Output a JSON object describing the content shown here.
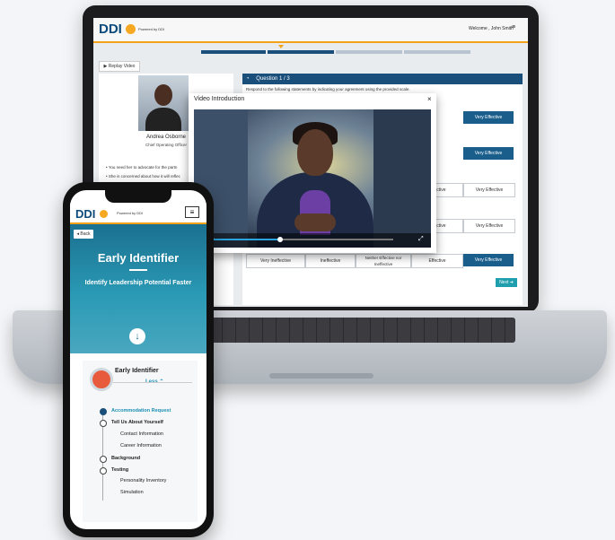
{
  "laptop": {
    "logo": "DDI",
    "powered_by": "Powered by DDI",
    "welcome": "Welcome , John Smith",
    "replay_video": "Replay Video",
    "profile": {
      "name": "Andrea Osborne",
      "role": "Chief Operating Officer",
      "bullets": [
        "You need her to advocate for the partn",
        "She is concerned about how it will reflec"
      ]
    },
    "question": {
      "title": "Question 1 / 3",
      "instruction": "Respond to the following statements by indicating your agreement using the provided scale."
    },
    "scale_options": [
      "Very Ineffective",
      "Ineffective",
      "Neither Effective nor Ineffective",
      "Effective",
      "Very Effective"
    ],
    "right_buttons": [
      "Very Effective",
      "Very Effective",
      "Very Effective",
      "Effective",
      "Effective"
    ],
    "next_label": "Next",
    "modal": {
      "title": "Video Introduction",
      "close": "×",
      "time": "0:31 / 1:17",
      "progress": 0.37
    }
  },
  "phone": {
    "logo": "DDI",
    "powered_by": "Powered by DDI",
    "back_label": "Back",
    "title": "Early Identifier",
    "subtitle": "Identify Leadership Potential Faster",
    "card_title": "Early Identifier",
    "less_label": "Less",
    "steps": [
      {
        "label": "Accommodation Request",
        "active": true
      },
      {
        "label": "Tell Us About Yourself",
        "active": false
      },
      {
        "label": "Contact Information",
        "sub": true
      },
      {
        "label": "Career Information",
        "sub": true
      },
      {
        "label": "Background",
        "active": false
      },
      {
        "label": "Testing",
        "active": false
      },
      {
        "label": "Personality Inventory",
        "sub": true
      },
      {
        "label": "Simulation",
        "sub": true
      }
    ]
  },
  "colors": {
    "brand_blue": "#1a4f7c",
    "accent_orange": "#f2a21a",
    "teal": "#1b7090",
    "link_blue": "#1b8fb4"
  }
}
